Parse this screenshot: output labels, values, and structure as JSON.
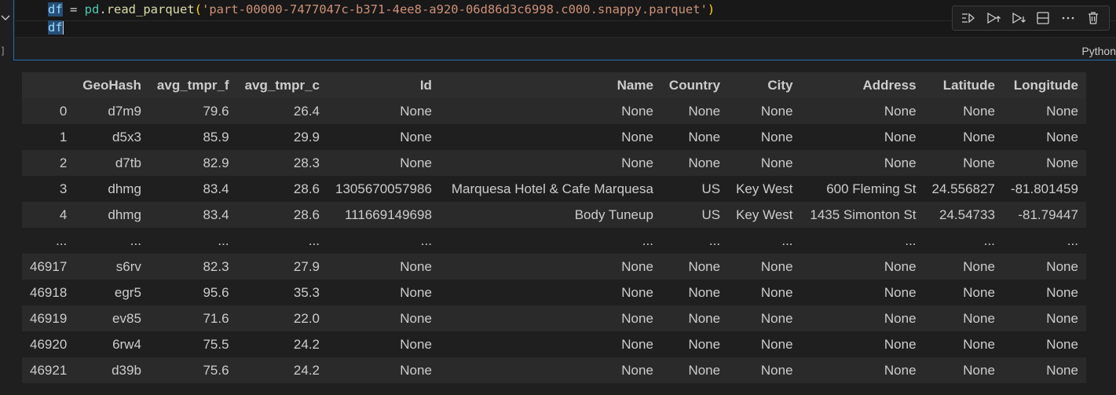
{
  "editor": {
    "line1": {
      "var": "df",
      "op": " = ",
      "module": "pd",
      "dot": ".",
      "func": "read_parquet",
      "open": "(",
      "string": "'part-00000-7477047c-b371-4ee8-a920-06d86d3c6998.c000.snappy.parquet'",
      "close": ")"
    },
    "line2": {
      "var": "df"
    }
  },
  "toolbar": {
    "icons": [
      "run-by-line-icon",
      "execute-above-icon",
      "execute-below-icon",
      "split-cell-icon",
      "more-icon",
      "delete-icon"
    ]
  },
  "cell": {
    "language": "Python"
  },
  "table": {
    "columns": [
      "",
      "GeoHash",
      "avg_tmpr_f",
      "avg_tmpr_c",
      "Id",
      "Name",
      "Country",
      "City",
      "Address",
      "Latitude",
      "Longitude"
    ],
    "rows": [
      [
        "0",
        "d7m9",
        "79.6",
        "26.4",
        "None",
        "None",
        "None",
        "None",
        "None",
        "None",
        "None"
      ],
      [
        "1",
        "d5x3",
        "85.9",
        "29.9",
        "None",
        "None",
        "None",
        "None",
        "None",
        "None",
        "None"
      ],
      [
        "2",
        "d7tb",
        "82.9",
        "28.3",
        "None",
        "None",
        "None",
        "None",
        "None",
        "None",
        "None"
      ],
      [
        "3",
        "dhmg",
        "83.4",
        "28.6",
        "1305670057986",
        "Marquesa Hotel & Cafe Marquesa",
        "US",
        "Key West",
        "600 Fleming St",
        "24.556827",
        "-81.801459"
      ],
      [
        "4",
        "dhmg",
        "83.4",
        "28.6",
        "111669149698",
        "Body Tuneup",
        "US",
        "Key West",
        "1435 Simonton St",
        "24.54733",
        "-81.79447"
      ],
      [
        "...",
        "...",
        "...",
        "...",
        "...",
        "...",
        "...",
        "...",
        "...",
        "...",
        "..."
      ],
      [
        "46917",
        "s6rv",
        "82.3",
        "27.9",
        "None",
        "None",
        "None",
        "None",
        "None",
        "None",
        "None"
      ],
      [
        "46918",
        "egr5",
        "95.6",
        "35.3",
        "None",
        "None",
        "None",
        "None",
        "None",
        "None",
        "None"
      ],
      [
        "46919",
        "ev85",
        "71.6",
        "22.0",
        "None",
        "None",
        "None",
        "None",
        "None",
        "None",
        "None"
      ],
      [
        "46920",
        "6rw4",
        "75.5",
        "24.2",
        "None",
        "None",
        "None",
        "None",
        "None",
        "None",
        "None"
      ],
      [
        "46921",
        "d39b",
        "75.6",
        "24.2",
        "None",
        "None",
        "None",
        "None",
        "None",
        "None",
        "None"
      ]
    ]
  },
  "colors": {
    "background": "#1f1f1f",
    "cell_border": "#1e6fb8",
    "string": "#ce9178",
    "variable": "#9cdcfe",
    "function": "#dcdcaa",
    "module": "#4ec9b0"
  }
}
